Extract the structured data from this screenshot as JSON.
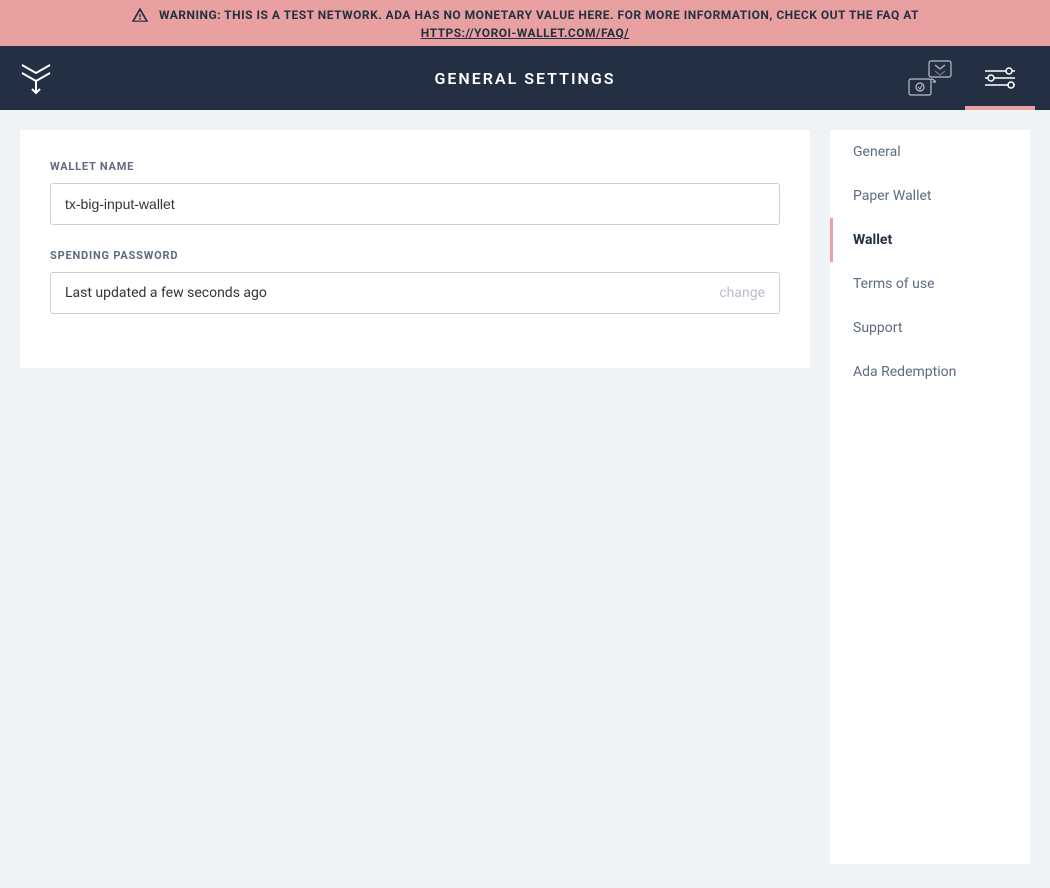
{
  "warning": {
    "text": "WARNING: THIS IS A TEST NETWORK. ADA HAS NO MONETARY VALUE HERE. FOR MORE INFORMATION, CHECK OUT THE FAQ AT",
    "link_text": "HTTPS://YOROI-WALLET.COM/FAQ/"
  },
  "header": {
    "title": "GENERAL SETTINGS"
  },
  "form": {
    "wallet_name": {
      "label": "WALLET NAME",
      "value": "tx-big-input-wallet"
    },
    "spending_password": {
      "label": "SPENDING PASSWORD",
      "status": "Last updated a few seconds ago",
      "change_label": "change"
    }
  },
  "sidebar": {
    "items": [
      {
        "label": "General"
      },
      {
        "label": "Paper Wallet"
      },
      {
        "label": "Wallet"
      },
      {
        "label": "Terms of use"
      },
      {
        "label": "Support"
      },
      {
        "label": "Ada Redemption"
      }
    ],
    "active_index": 2
  }
}
